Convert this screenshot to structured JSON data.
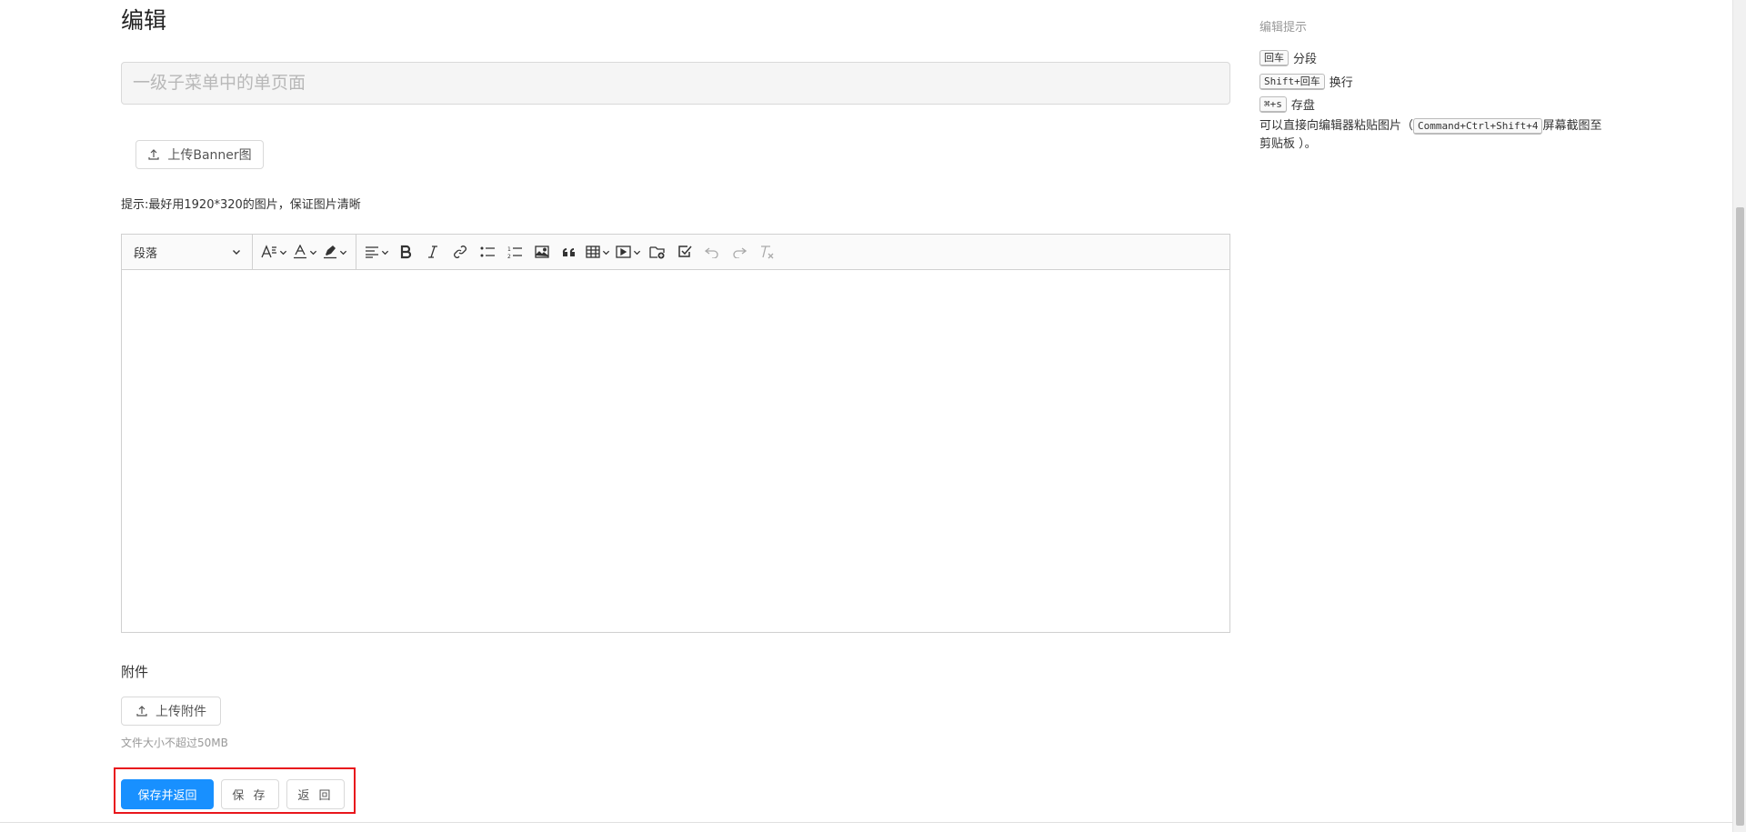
{
  "page": {
    "title": "编辑"
  },
  "form": {
    "title_placeholder": "一级子菜单中的单页面",
    "banner_upload_label": "上传Banner图",
    "banner_hint": "提示:最好用1920*320的图片，保证图片清晰"
  },
  "editor": {
    "paragraph_select": "段落",
    "toolbar_icons": [
      "font-size-icon",
      "font-color-icon",
      "background-color-icon",
      "align-icon",
      "bold-icon",
      "italic-icon",
      "link-icon",
      "bulleted-list-icon",
      "numbered-list-icon",
      "image-icon",
      "quote-icon",
      "table-icon",
      "video-icon",
      "insert-file-icon",
      "todo-icon",
      "undo-icon",
      "redo-icon",
      "clear-format-icon"
    ]
  },
  "attachments": {
    "label": "附件",
    "upload_label": "上传附件",
    "size_note": "文件大小不超过50MB"
  },
  "actions": {
    "save_and_return": "保存并返回",
    "save": "保 存",
    "back": "返 回",
    "highlight_color": "#e8161c",
    "primary_color": "#1890ff"
  },
  "sidebar": {
    "title": "编辑提示",
    "shortcuts": [
      {
        "key": "回车",
        "desc": "分段"
      },
      {
        "key": "Shift+回车",
        "desc": "换行"
      },
      {
        "key": "⌘+s",
        "desc": "存盘"
      }
    ],
    "paste_tip_prefix": "可以直接向编辑器粘贴图片（",
    "paste_tip_key": "Command+Ctrl+Shift+4",
    "paste_tip_suffix": "屏幕截图至剪贴板 ）。"
  }
}
